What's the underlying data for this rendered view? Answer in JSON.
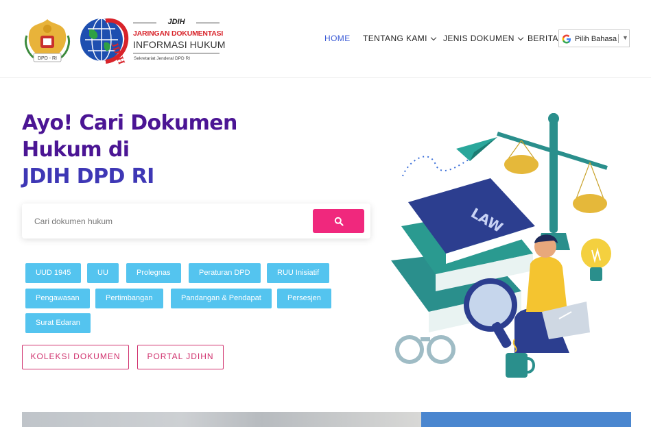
{
  "header": {
    "brand": {
      "top": "JDIH",
      "line1": "JARINGAN DOKUMENTASI",
      "line2": "INFORMASI HUKUM",
      "line3": "Sekretariat Jenderal DPD RI",
      "seal_text": "DPD - RI",
      "logo_mark": "JDIH"
    },
    "nav": {
      "items": [
        {
          "label": "HOME",
          "active": true
        },
        {
          "label": "TENTANG KAMI",
          "dropdown": true,
          "icon": "chevron-down-icon"
        },
        {
          "label": "JENIS DOKUMEN",
          "dropdown": true,
          "icon": "chevron-down-icon"
        },
        {
          "label": "BERITA"
        }
      ]
    },
    "language": {
      "label": "Pilih Bahasa",
      "icon": "google-icon"
    }
  },
  "hero": {
    "title_line1": "Ayo! Cari Dokumen",
    "title_line2": "Hukum di",
    "title_line3": "JDIH DPD RI"
  },
  "search": {
    "placeholder": "Cari dokumen hukum",
    "value": "",
    "button_icon": "search-icon"
  },
  "tags": [
    "UUD 1945",
    "UU",
    "Prolegnas",
    "Peraturan DPD",
    "RUU Inisiatif",
    "Pengawasan",
    "Pertimbangan",
    "Pandangan & Pendapat",
    "Persesjen",
    "Surat Edaran"
  ],
  "buttons": {
    "koleksi": "KOLEKSI DOKUMEN",
    "portal": "PORTAL JDIHN"
  },
  "illustration": {
    "book_label": "LAW"
  },
  "colors": {
    "title": "#4b1594",
    "title_accent": "#3e37b5",
    "nav_active": "#3b5bd6",
    "search_button": "#f0287d",
    "tag": "#54c4ef",
    "outline_button": "#d0306d"
  }
}
